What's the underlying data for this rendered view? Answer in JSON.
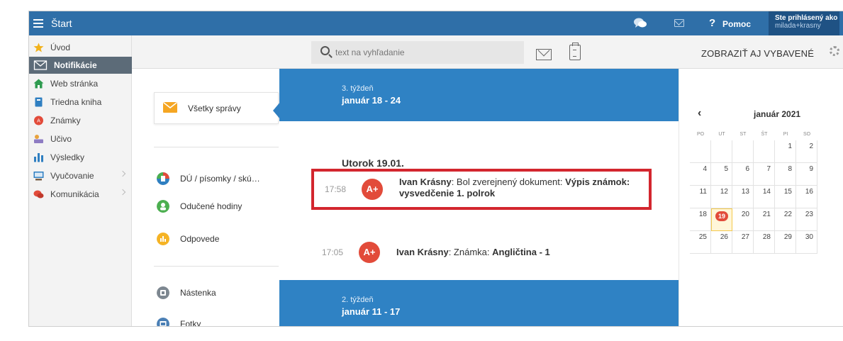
{
  "topbar": {
    "menu_label": "Štart",
    "help_label": "Pomoc",
    "help_symbol": "?",
    "user_line1": "Ste prihlásený ako",
    "user_line2": "milada+krasny"
  },
  "sidebar": {
    "items": [
      {
        "label": "Úvod",
        "icon": "star-icon",
        "color": "#f2b21b"
      },
      {
        "label": "Notifikácie",
        "icon": "envelope-icon",
        "color": "#ffffff"
      },
      {
        "label": "Web stránka",
        "icon": "home-icon",
        "color": "#2e9b4f"
      },
      {
        "label": "Triedna kniha",
        "icon": "book-icon",
        "color": "#2f7fc1"
      },
      {
        "label": "Známky",
        "icon": "grades-icon",
        "color": "#e24b3a"
      },
      {
        "label": "Učivo",
        "icon": "learning-icon",
        "color": "#9b59b6"
      },
      {
        "label": "Výsledky",
        "icon": "bar-chart-icon",
        "color": "#2f7fc1"
      },
      {
        "label": "Vyučovanie",
        "icon": "classroom-icon",
        "color": "#2f7fc1"
      },
      {
        "label": "Komunikácia",
        "icon": "chat-icon",
        "color": "#e24b3a"
      }
    ]
  },
  "search": {
    "placeholder": "text na vyhľadanie"
  },
  "toolbar": {
    "show_selected_label": "ZOBRAZIŤ AJ VYBAVENÉ"
  },
  "folders": {
    "active": {
      "label": "Všetky správy",
      "icon": "mail-icon",
      "color": "#f5a623"
    },
    "items": [
      {
        "label": "DÚ / písomky / skú…",
        "icon": "homework-icon",
        "color": "#2f7fc1"
      },
      {
        "label": "Odučené hodiny",
        "icon": "lessons-icon",
        "color": "#4caf50"
      },
      {
        "label": "Odpovede",
        "icon": "answers-icon",
        "color": "#f5b324"
      },
      {
        "label": "Nástenka",
        "icon": "board-icon",
        "color": "#7d8790"
      },
      {
        "label": "Fotky",
        "icon": "photos-icon",
        "color": "#4a7fb5"
      }
    ]
  },
  "messages": {
    "week_current": {
      "week": "3. týždeň",
      "range": "január 18 - 24"
    },
    "day_heading": "Utorok 19.01.",
    "items": [
      {
        "time": "17:58",
        "avatar": "A+",
        "sender": "Ivan Krásny",
        "text": ": Bol zverejnený dokument: ",
        "bold": "Výpis známok: vysvedčenie 1. polrok"
      },
      {
        "time": "17:05",
        "avatar": "A+",
        "sender": "Ivan Krásny",
        "text": ": Známka: ",
        "bold": "Angličtina - 1"
      }
    ],
    "week_prev": {
      "week": "2. týždeň",
      "range": "január 11 - 17"
    }
  },
  "calendar": {
    "prev_symbol": "‹",
    "title": "január 2021",
    "dow": [
      "PO",
      "UT",
      "ST",
      "ŠT",
      "PI",
      "SO"
    ],
    "weeks": [
      [
        "",
        "",
        "",
        "",
        "1",
        "2"
      ],
      [
        "4",
        "5",
        "6",
        "7",
        "8",
        "9"
      ],
      [
        "11",
        "12",
        "13",
        "14",
        "15",
        "16"
      ],
      [
        "18",
        "19",
        "20",
        "21",
        "22",
        "23"
      ],
      [
        "25",
        "26",
        "27",
        "28",
        "29",
        "30"
      ]
    ],
    "today": "19"
  }
}
